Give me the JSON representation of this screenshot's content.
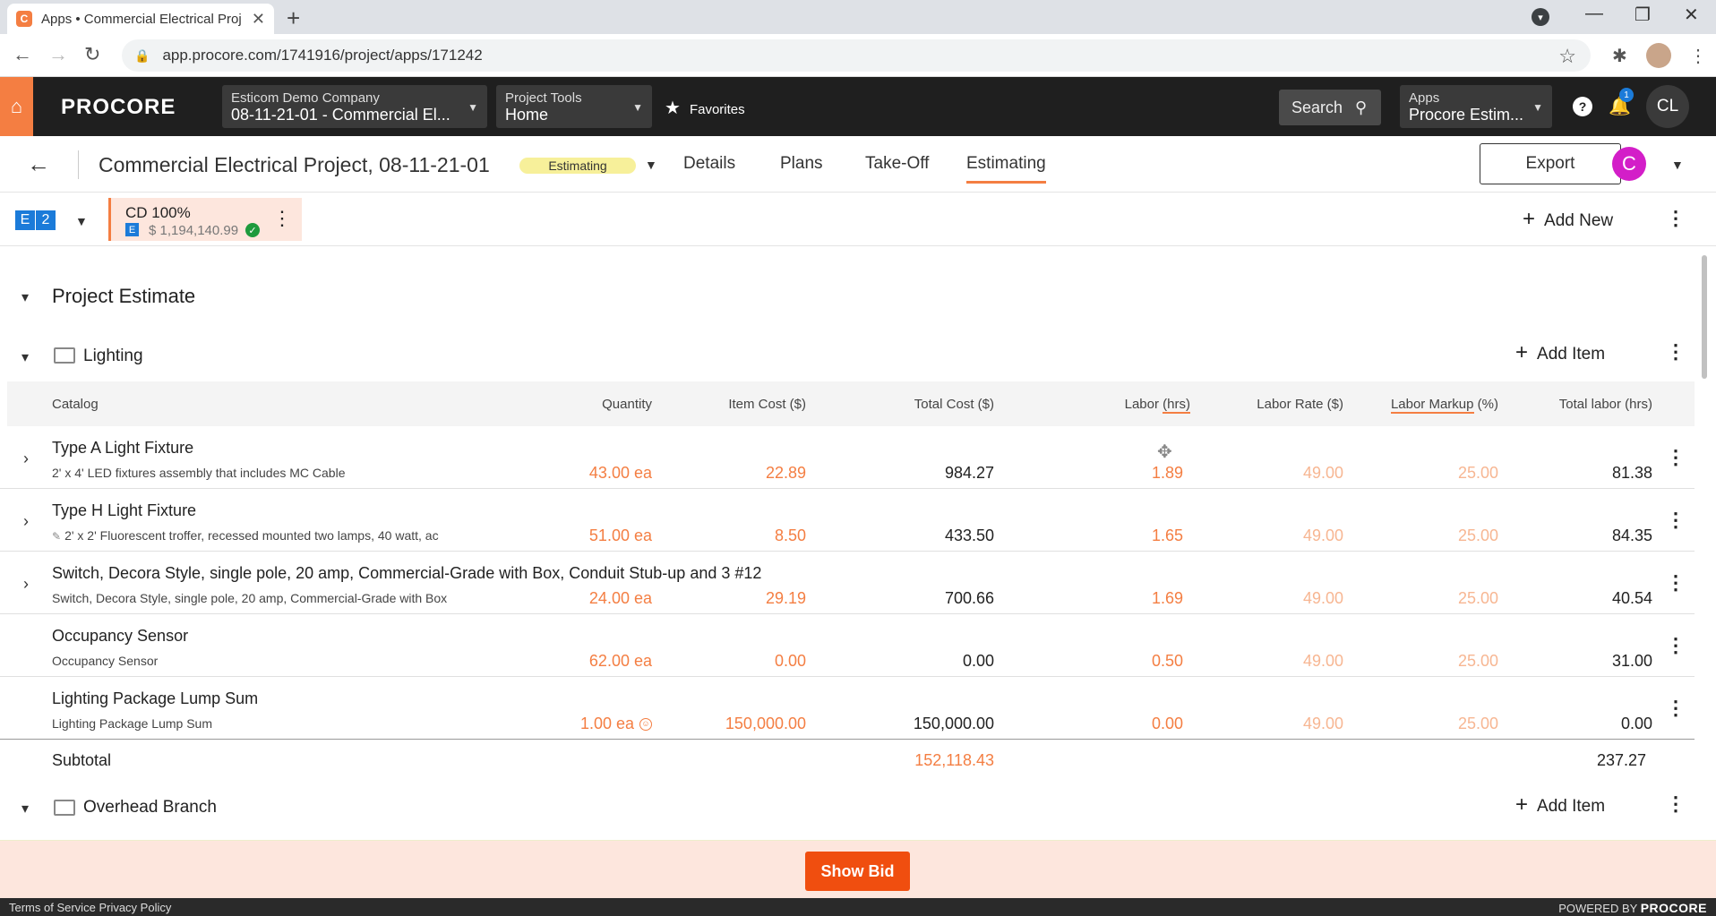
{
  "browser": {
    "tab_title": "Apps • Commercial Electrical Proj",
    "url": "app.procore.com/1741916/project/apps/171242",
    "favicon_letter": "C"
  },
  "header": {
    "logo": "PROCORE",
    "company": "Esticom Demo Company",
    "project": "08-11-21-01 - Commercial El...",
    "tools_label": "Project Tools",
    "tools_value": "Home",
    "favorites": "Favorites",
    "search": "Search",
    "apps_label": "Apps",
    "apps_value": "Procore Estim...",
    "notification_count": "1",
    "user_initials": "CL"
  },
  "project_bar": {
    "title": "Commercial Electrical Project, 08-11-21-01",
    "status": "Estimating",
    "tabs": [
      "Details",
      "Plans",
      "Take-Off",
      "Estimating"
    ],
    "active_tab": "Estimating",
    "export": "Export",
    "avatar_letter": "C"
  },
  "estimate_bar": {
    "e_label": "E",
    "version": "2",
    "card_title": "CD 100%",
    "card_e": "E",
    "card_amount": "$ 1,194,140.99",
    "add_new": "Add New"
  },
  "content": {
    "section_title": "Project Estimate",
    "group1": "Lighting",
    "group2": "Overhead Branch",
    "add_item": "Add Item",
    "columns": {
      "catalog": "Catalog",
      "quantity": "Quantity",
      "item_cost": "Item Cost ($)",
      "total_cost": "Total Cost ($)",
      "labor_a": "Labor",
      "labor_b": "(hrs)",
      "labor_rate": "Labor Rate ($)",
      "labor_markup_a": "Labor Markup",
      "labor_markup_b": "(%)",
      "total_labor": "Total labor (hrs)"
    },
    "rows": [
      {
        "name": "Type A Light Fixture",
        "desc": "2' x 4' LED fixtures assembly that includes MC Cable",
        "qty": "43.00 ea",
        "item_cost": "22.89",
        "total_cost": "984.27",
        "labor": "1.89",
        "labor_rate": "49.00",
        "markup": "25.00",
        "total_labor": "81.38"
      },
      {
        "name": "Type H Light Fixture",
        "desc": "2' x 2' Fluorescent troffer, recessed mounted two lamps, 40 watt, ac",
        "qty": "51.00 ea",
        "item_cost": "8.50",
        "total_cost": "433.50",
        "labor": "1.65",
        "labor_rate": "49.00",
        "markup": "25.00",
        "total_labor": "84.35"
      },
      {
        "name": "Switch, Decora Style, single pole, 20 amp, Commercial-Grade with Box, Conduit Stub-up and 3 #12",
        "desc": "Switch, Decora Style, single pole, 20 amp, Commercial-Grade with Box",
        "qty": "24.00 ea",
        "item_cost": "29.19",
        "total_cost": "700.66",
        "labor": "1.69",
        "labor_rate": "49.00",
        "markup": "25.00",
        "total_labor": "40.54"
      },
      {
        "name": "Occupancy Sensor",
        "desc": "Occupancy Sensor",
        "qty": "62.00 ea",
        "item_cost": "0.00",
        "total_cost": "0.00",
        "labor": "0.50",
        "labor_rate": "49.00",
        "markup": "25.00",
        "total_labor": "31.00"
      },
      {
        "name": "Lighting Package Lump Sum",
        "desc": "Lighting Package Lump Sum",
        "qty": "1.00 ea",
        "item_cost": "150,000.00",
        "total_cost": "150,000.00",
        "labor": "0.00",
        "labor_rate": "49.00",
        "markup": "25.00",
        "total_labor": "0.00"
      }
    ],
    "subtotal_label": "Subtotal",
    "subtotal_cost": "152,118.43",
    "subtotal_labor": "237.27"
  },
  "bottom": {
    "show_bid": "Show Bid",
    "terms": "Terms of Service",
    "privacy": "Privacy Policy",
    "powered_by": "POWERED BY",
    "powered_brand": "PROCORE"
  },
  "colors": {
    "accent": "#f47e42",
    "dark_header": "#1f1f1f",
    "blue": "#1b7bd9"
  }
}
